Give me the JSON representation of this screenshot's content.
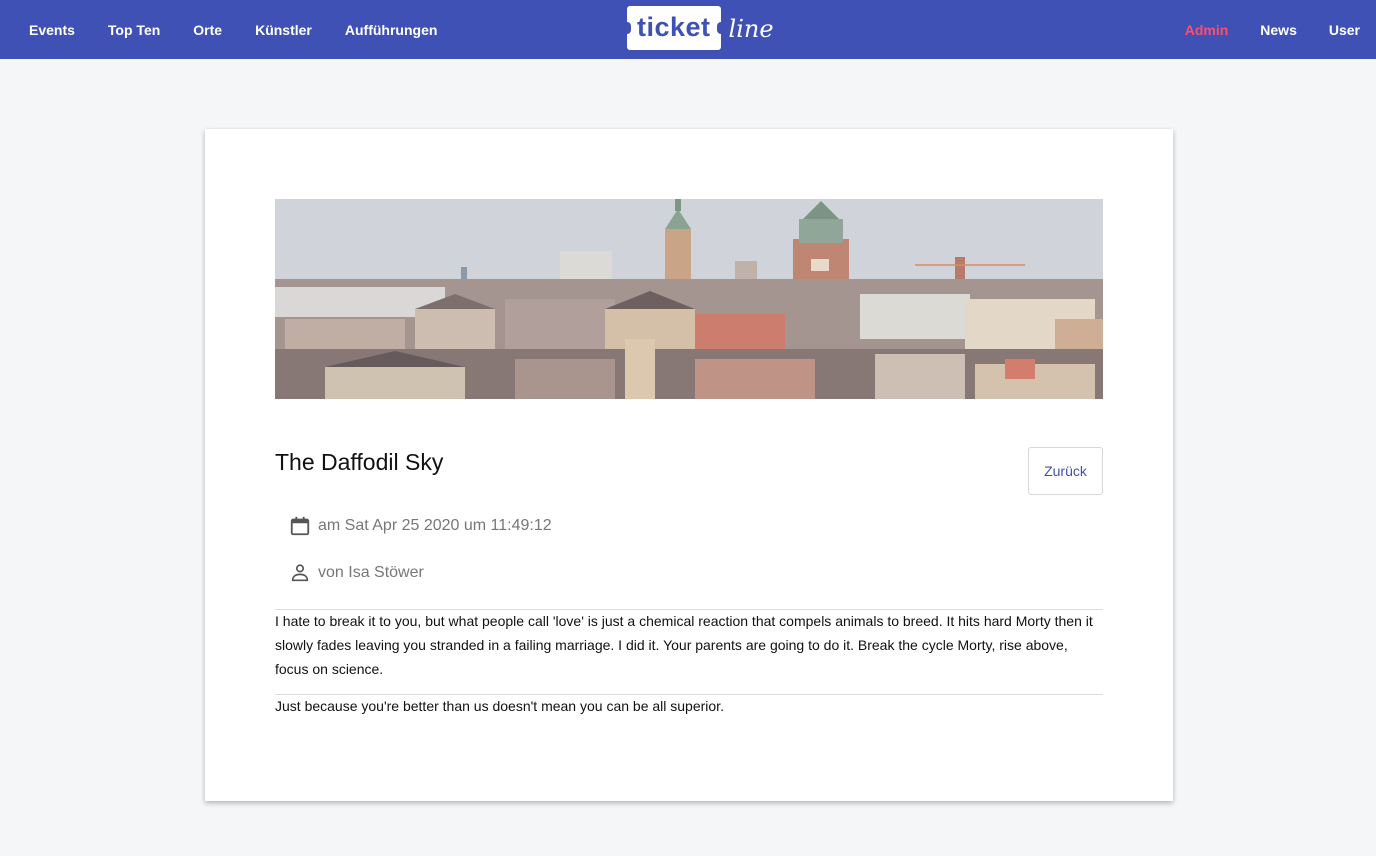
{
  "nav": {
    "left": [
      "Events",
      "Top Ten",
      "Orte",
      "Künstler",
      "Aufführungen"
    ],
    "right": [
      "Admin",
      "News",
      "User"
    ],
    "logo_ticket": "ticket",
    "logo_line": "line"
  },
  "colors": {
    "primary": "#3f51b5",
    "admin": "#ff4d6d",
    "page_bg": "#f5f6f8"
  },
  "article": {
    "title": "The Daffodil Sky",
    "back_label": "Zurück",
    "date": "am Sat Apr 25 2020 um 11:49:12",
    "author": "von Isa Stöwer",
    "paragraphs": [
      "I hate to break it to you, but what people call 'love' is just a chemical reaction that compels animals to breed. It hits hard Morty then it slowly fades leaving you stranded in a failing marriage. I did it. Your parents are going to do it. Break the cycle Morty, rise above, focus on science.",
      "Just because you're better than us doesn't mean you can be all superior."
    ]
  },
  "icons": {
    "date": "calendar-icon",
    "author": "person-icon"
  }
}
